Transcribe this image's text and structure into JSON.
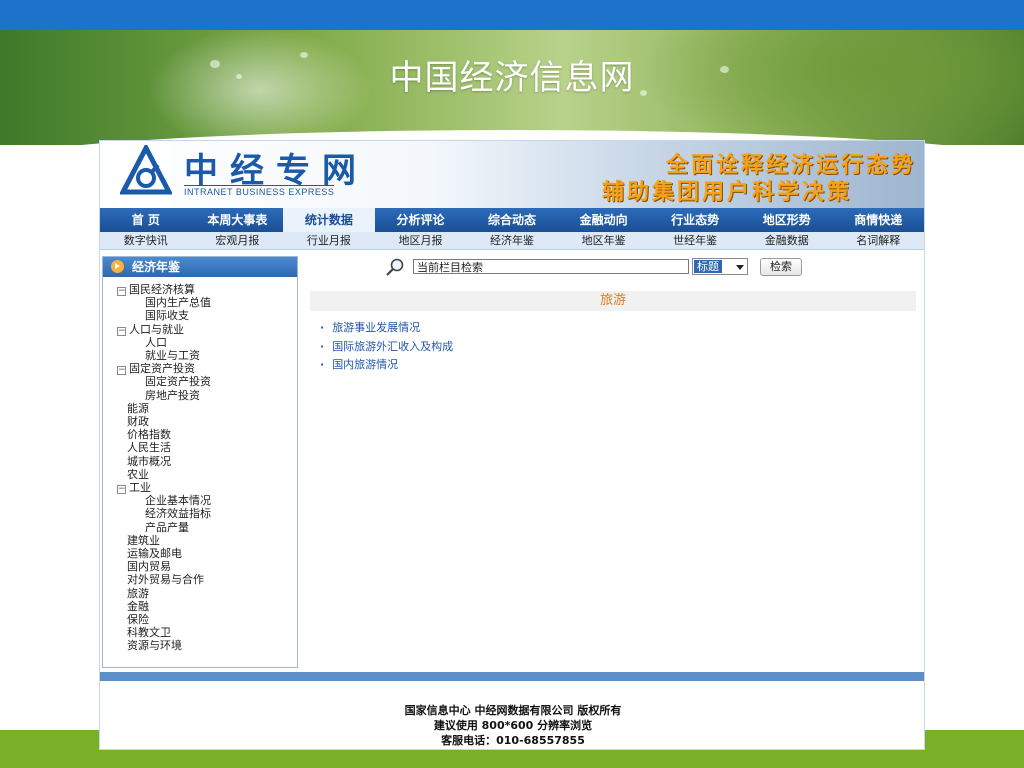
{
  "slide": {
    "title": "中国经济信息网",
    "colors": {
      "top_bar": "#1d73c9",
      "bottom_band": "#79b02a"
    }
  },
  "site": {
    "logo_name": "中经专网",
    "logo_sub": "INTRANET BUSINESS EXPRESS",
    "slogan_line1": "全面诠释经济运行态势",
    "slogan_line2": "辅助集团用户科学决策",
    "colors": {
      "brand_blue": "#1a5aa8",
      "slogan_orange": "#f4a21a"
    }
  },
  "nav_main": [
    {
      "label": "首 页"
    },
    {
      "label": "本周大事表"
    },
    {
      "label": "统计数据",
      "active": true
    },
    {
      "label": "分析评论"
    },
    {
      "label": "综合动态"
    },
    {
      "label": "金融动向"
    },
    {
      "label": "行业态势"
    },
    {
      "label": "地区形势"
    },
    {
      "label": "商情快递"
    }
  ],
  "nav_sub": [
    {
      "label": "数字快讯"
    },
    {
      "label": "宏观月报"
    },
    {
      "label": "行业月报"
    },
    {
      "label": "地区月报"
    },
    {
      "label": "经济年鉴"
    },
    {
      "label": "地区年鉴"
    },
    {
      "label": "世经年鉴"
    },
    {
      "label": "金融数据"
    },
    {
      "label": "名词解释"
    }
  ],
  "sidebar": {
    "title": "经济年鉴",
    "tree": [
      {
        "label": "国民经济核算",
        "level": 0,
        "expander": "−"
      },
      {
        "label": "国内生产总值",
        "level": 1
      },
      {
        "label": "国际收支",
        "level": 1
      },
      {
        "label": "人口与就业",
        "level": 0,
        "expander": "−"
      },
      {
        "label": "人口",
        "level": 1
      },
      {
        "label": "就业与工资",
        "level": 1
      },
      {
        "label": "固定资产投资",
        "level": 0,
        "expander": "−"
      },
      {
        "label": "固定资产投资",
        "level": 1
      },
      {
        "label": "房地产投资",
        "level": 1
      },
      {
        "label": "能源",
        "level": 0
      },
      {
        "label": "财政",
        "level": 0
      },
      {
        "label": "价格指数",
        "level": 0
      },
      {
        "label": "人民生活",
        "level": 0
      },
      {
        "label": "城市概况",
        "level": 0
      },
      {
        "label": "农业",
        "level": 0
      },
      {
        "label": "工业",
        "level": 0,
        "expander": "−"
      },
      {
        "label": "企业基本情况",
        "level": 1
      },
      {
        "label": "经济效益指标",
        "level": 1
      },
      {
        "label": "产品产量",
        "level": 1
      },
      {
        "label": "建筑业",
        "level": 0
      },
      {
        "label": "运输及邮电",
        "level": 0
      },
      {
        "label": "国内贸易",
        "level": 0
      },
      {
        "label": "对外贸易与合作",
        "level": 0
      },
      {
        "label": "旅游",
        "level": 0
      },
      {
        "label": "金融",
        "level": 0
      },
      {
        "label": "保险",
        "level": 0
      },
      {
        "label": "科教文卫",
        "level": 0
      },
      {
        "label": "资源与环境",
        "level": 0
      }
    ]
  },
  "search": {
    "input_value": "当前栏目检索",
    "select_value": "标题",
    "button_label": "检索"
  },
  "content": {
    "section_title": "旅游",
    "links": [
      {
        "label": "旅游事业发展情况"
      },
      {
        "label": "国际旅游外汇收入及构成"
      },
      {
        "label": "国内旅游情况"
      }
    ]
  },
  "footer": {
    "line1": "国家信息中心 中经网数据有限公司 版权所有",
    "line2": "建议使用 800*600 分辨率浏览",
    "line3": "客服电话：010-68557855"
  }
}
